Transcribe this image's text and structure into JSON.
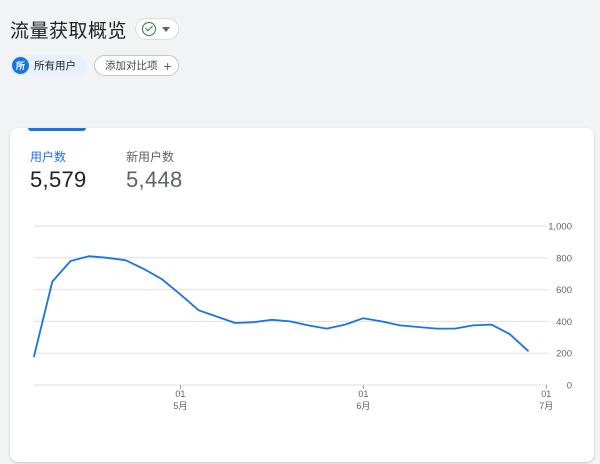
{
  "header": {
    "title": "流量获取概览"
  },
  "filters": {
    "segment_badge": "所",
    "segment_label": "所有用户",
    "add_label": "添加对比项"
  },
  "metrics": [
    {
      "label": "用户数",
      "value": "5,579",
      "active": true
    },
    {
      "label": "新用户数",
      "value": "5,448",
      "active": false
    }
  ],
  "colors": {
    "line": "#1a73e8",
    "grid": "#e0e0e0",
    "accent": "#1a73e8",
    "check": "#188038"
  },
  "chart_data": {
    "type": "line",
    "title": "",
    "xlabel": "",
    "ylabel": "",
    "ylim": [
      0,
      1000
    ],
    "yticks": [
      0,
      200,
      400,
      600,
      800,
      1000
    ],
    "ytick_labels": [
      "0",
      "200",
      "400",
      "600",
      "800",
      "1,000"
    ],
    "xticks": [
      {
        "index": 8,
        "day": "01",
        "month": "5月"
      },
      {
        "index": 18,
        "day": "01",
        "month": "6月"
      },
      {
        "index": 28,
        "day": "01",
        "month": "7月"
      }
    ],
    "series": [
      {
        "values": [
          180,
          650,
          780,
          810,
          800,
          785,
          730,
          665,
          570,
          470,
          430,
          390,
          395,
          410,
          400,
          375,
          355,
          380,
          420,
          400,
          375,
          365,
          355,
          355,
          375,
          380,
          320,
          215
        ]
      }
    ]
  }
}
